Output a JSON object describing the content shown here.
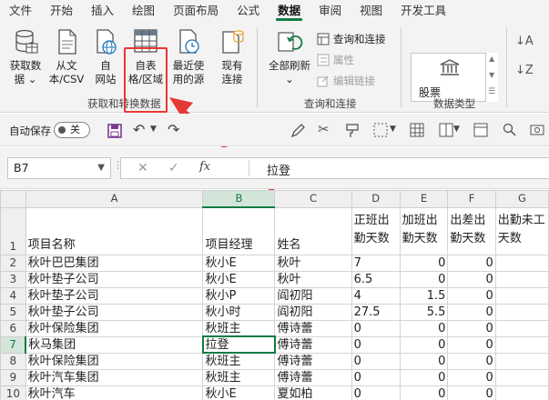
{
  "tabs": [
    "文件",
    "开始",
    "插入",
    "绘图",
    "页面布局",
    "公式",
    "数据",
    "审阅",
    "视图",
    "开发工具"
  ],
  "active_tab": "数据",
  "ribbon": {
    "get_data": {
      "buttons": [
        {
          "line1": "获取数",
          "line2": "据 ⌄"
        },
        {
          "line1": "从文",
          "line2": "本/CSV"
        },
        {
          "line1": "自",
          "line2": "网站"
        },
        {
          "line1": "自表",
          "line2": "格/区域"
        },
        {
          "line1": "最近使",
          "line2": "用的源"
        },
        {
          "line1": "现有",
          "line2": "连接"
        }
      ],
      "group_label": "获取和转换数据"
    },
    "queries": {
      "refresh_all": {
        "line1": "全部刷新",
        "line2": "⌄"
      },
      "items": [
        "查询和连接",
        "属性",
        "编辑链接"
      ],
      "group_label": "查询和连接"
    },
    "data_types": {
      "stock_label": "股票",
      "group_label": "数据类型"
    }
  },
  "qat": {
    "autosave_label": "自动保存",
    "toggle_text": "关"
  },
  "formula_bar": {
    "name_box": "B7",
    "fx": "fx",
    "value": "拉登"
  },
  "sheet": {
    "columns": [
      "A",
      "B",
      "C",
      "D",
      "E",
      "F",
      "G"
    ],
    "header_row": [
      "项目名称",
      "项目经理",
      "姓名",
      "正班出勤天数",
      "加班出勤天数",
      "出差出勤天数",
      "出勤未工天数"
    ],
    "rows": [
      {
        "n": "2",
        "cells": [
          "秋叶巴巴集团",
          "秋小E",
          "秋叶",
          "7",
          "0",
          "0",
          ""
        ]
      },
      {
        "n": "3",
        "cells": [
          "秋叶垫子公司",
          "秋小E",
          "秋叶",
          "6.5",
          "0",
          "0",
          ""
        ]
      },
      {
        "n": "4",
        "cells": [
          "秋叶垫子公司",
          "秋小P",
          "阎初阳",
          "4",
          "1.5",
          "0",
          ""
        ]
      },
      {
        "n": "5",
        "cells": [
          "秋叶垫子公司",
          "秋小时",
          "阎初阳",
          "27.5",
          "5.5",
          "0",
          ""
        ]
      },
      {
        "n": "6",
        "cells": [
          "秋叶保险集团",
          "秋班主",
          "傅诗蕾",
          "0",
          "0",
          "0",
          ""
        ]
      },
      {
        "n": "7",
        "cells": [
          "秋马集团",
          "拉登",
          "傅诗蕾",
          "0",
          "0",
          "0",
          ""
        ]
      },
      {
        "n": "8",
        "cells": [
          "秋叶保险集团",
          "秋班主",
          "傅诗蕾",
          "0",
          "0",
          "0",
          ""
        ]
      },
      {
        "n": "9",
        "cells": [
          "秋叶汽车集团",
          "秋班主",
          "傅诗蕾",
          "0",
          "0",
          "0",
          ""
        ]
      },
      {
        "n": "10",
        "cells": [
          "秋叶汽车",
          "秋小E",
          "夏如柏",
          "0",
          "0",
          "0",
          ""
        ]
      }
    ]
  },
  "colors": {
    "accent_green": "#107c41",
    "highlight_red": "#e53935"
  }
}
